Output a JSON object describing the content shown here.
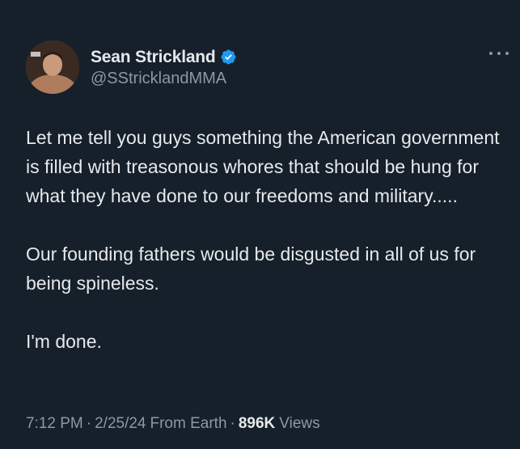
{
  "user": {
    "display_name": "Sean Strickland",
    "handle": "@SStricklandMMA",
    "verified": true,
    "verified_color": "#1d9bf0"
  },
  "tweet": {
    "paragraphs": [
      "Let me tell you guys something the American government is filled with treasonous whores that should be hung for what they have done to our freedoms and military.....",
      "Our founding fathers would be disgusted in all of us for being spineless.",
      "I'm done."
    ],
    "time": "7:12 PM",
    "date": "2/25/24",
    "source": "From Earth",
    "views_count": "896K",
    "views_label": "Views",
    "separator": "·"
  },
  "icons": {
    "more": "more-horizontal-icon",
    "verified": "verified-badge-icon"
  },
  "colors": {
    "background": "#15202b",
    "text_primary": "#e7e9ea",
    "text_secondary": "#8b98a5"
  }
}
